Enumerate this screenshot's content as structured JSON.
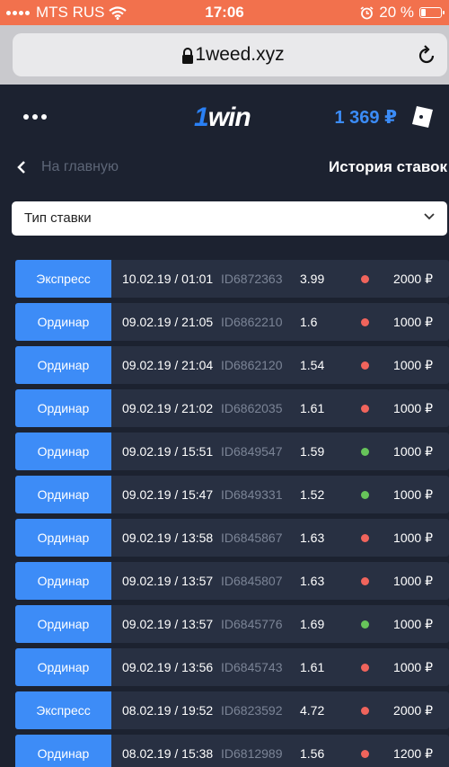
{
  "status_bar": {
    "carrier": "MTS RUS",
    "time": "17:06",
    "battery": "20 %",
    "battery_level": 0.2
  },
  "browser": {
    "url": "1weed.xyz"
  },
  "header": {
    "logo_prefix": "1",
    "logo_suffix": "win",
    "balance": "1 369 ₽"
  },
  "nav": {
    "back_label": "На главную",
    "title": "История ставок"
  },
  "filter": {
    "label": "Тип ставки"
  },
  "colors": {
    "accent": "#3d8cf7",
    "lost": "#f0645c",
    "won": "#67c45a",
    "status_bar": "#f2714d"
  },
  "bets": [
    {
      "type": "Экспресс",
      "date": "10.02.19 / 01:01",
      "id": "ID6872363",
      "odds": "3.99",
      "result": "lost",
      "amount": "2000 ₽"
    },
    {
      "type": "Ординар",
      "date": "09.02.19 / 21:05",
      "id": "ID6862210",
      "odds": "1.6",
      "result": "lost",
      "amount": "1000 ₽"
    },
    {
      "type": "Ординар",
      "date": "09.02.19 / 21:04",
      "id": "ID6862120",
      "odds": "1.54",
      "result": "lost",
      "amount": "1000 ₽"
    },
    {
      "type": "Ординар",
      "date": "09.02.19 / 21:02",
      "id": "ID6862035",
      "odds": "1.61",
      "result": "lost",
      "amount": "1000 ₽"
    },
    {
      "type": "Ординар",
      "date": "09.02.19 / 15:51",
      "id": "ID6849547",
      "odds": "1.59",
      "result": "won",
      "amount": "1000 ₽"
    },
    {
      "type": "Ординар",
      "date": "09.02.19 / 15:47",
      "id": "ID6849331",
      "odds": "1.52",
      "result": "won",
      "amount": "1000 ₽"
    },
    {
      "type": "Ординар",
      "date": "09.02.19 / 13:58",
      "id": "ID6845867",
      "odds": "1.63",
      "result": "lost",
      "amount": "1000 ₽"
    },
    {
      "type": "Ординар",
      "date": "09.02.19 / 13:57",
      "id": "ID6845807",
      "odds": "1.63",
      "result": "lost",
      "amount": "1000 ₽"
    },
    {
      "type": "Ординар",
      "date": "09.02.19 / 13:57",
      "id": "ID6845776",
      "odds": "1.69",
      "result": "won",
      "amount": "1000 ₽"
    },
    {
      "type": "Ординар",
      "date": "09.02.19 / 13:56",
      "id": "ID6845743",
      "odds": "1.61",
      "result": "lost",
      "amount": "1000 ₽"
    },
    {
      "type": "Экспресс",
      "date": "08.02.19 / 19:52",
      "id": "ID6823592",
      "odds": "4.72",
      "result": "lost",
      "amount": "2000 ₽"
    },
    {
      "type": "Ординар",
      "date": "08.02.19 / 15:38",
      "id": "ID6812989",
      "odds": "1.56",
      "result": "lost",
      "amount": "1200 ₽"
    }
  ]
}
